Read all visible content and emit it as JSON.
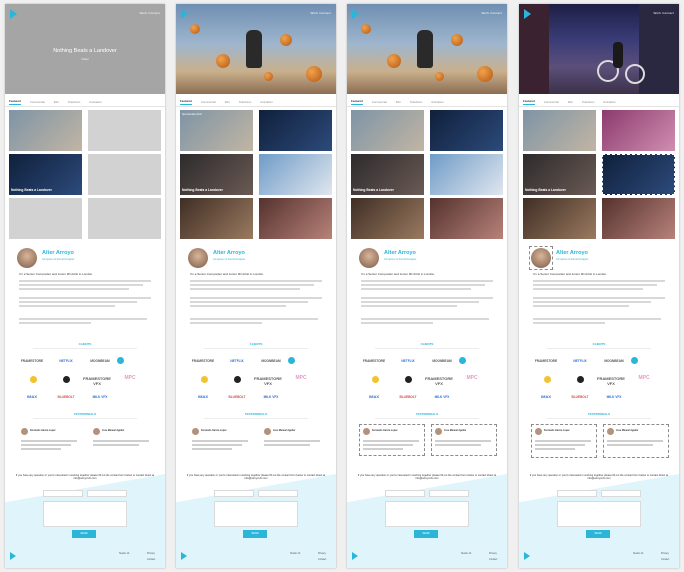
{
  "nav": {
    "top_links": "Work  Contact"
  },
  "hero": {
    "title": "Nothing Beats a Landover",
    "subtitle": "Video"
  },
  "tabs": [
    "Featured",
    "Commercial",
    "Film",
    "Television",
    "Animation"
  ],
  "thumbnails": {
    "label_landover": "Nothing Beats a Landover",
    "tag_small": "Spectaculars Roll"
  },
  "profile": {
    "name": "Alter Arroyo",
    "role": "Composer & Sound Designer",
    "tagline": "I'm a Senior Compositor and Junior 3D Artist in London."
  },
  "clients": {
    "title": "CLIENTS",
    "logos": [
      "FRAMESTORE",
      "NETFLIX",
      "MOONBEAM",
      "DOUBLE NEGATIVE",
      "ANIMAL LOGIC",
      "DIGITAL",
      "FRAMESTORE VFX",
      "MPC",
      "IMAX",
      "BLUEBOLT",
      "MILK VFX"
    ]
  },
  "testimonials": {
    "title": "TESTIMONIALS",
    "people": [
      {
        "name": "Fernando Garcia Lopez",
        "quote": "Alter is the epitome of working with..."
      },
      {
        "name": "Jose Manuel Aguilar",
        "quote": "Working with Alter was a seamless..."
      }
    ]
  },
  "contact": {
    "text": "If you have any question or you're interested in working together please fill out the contact form below or contact direct at info@arroyovfx.com",
    "send_label": "SEND",
    "name_placeholder": "Name",
    "email_placeholder": "Email",
    "message_placeholder": "Your message"
  },
  "footer": {
    "c1": "Studio 1A",
    "c2": "Privacy",
    "c3": "Contact"
  },
  "colors": {
    "accent": "#2bb5d9"
  }
}
